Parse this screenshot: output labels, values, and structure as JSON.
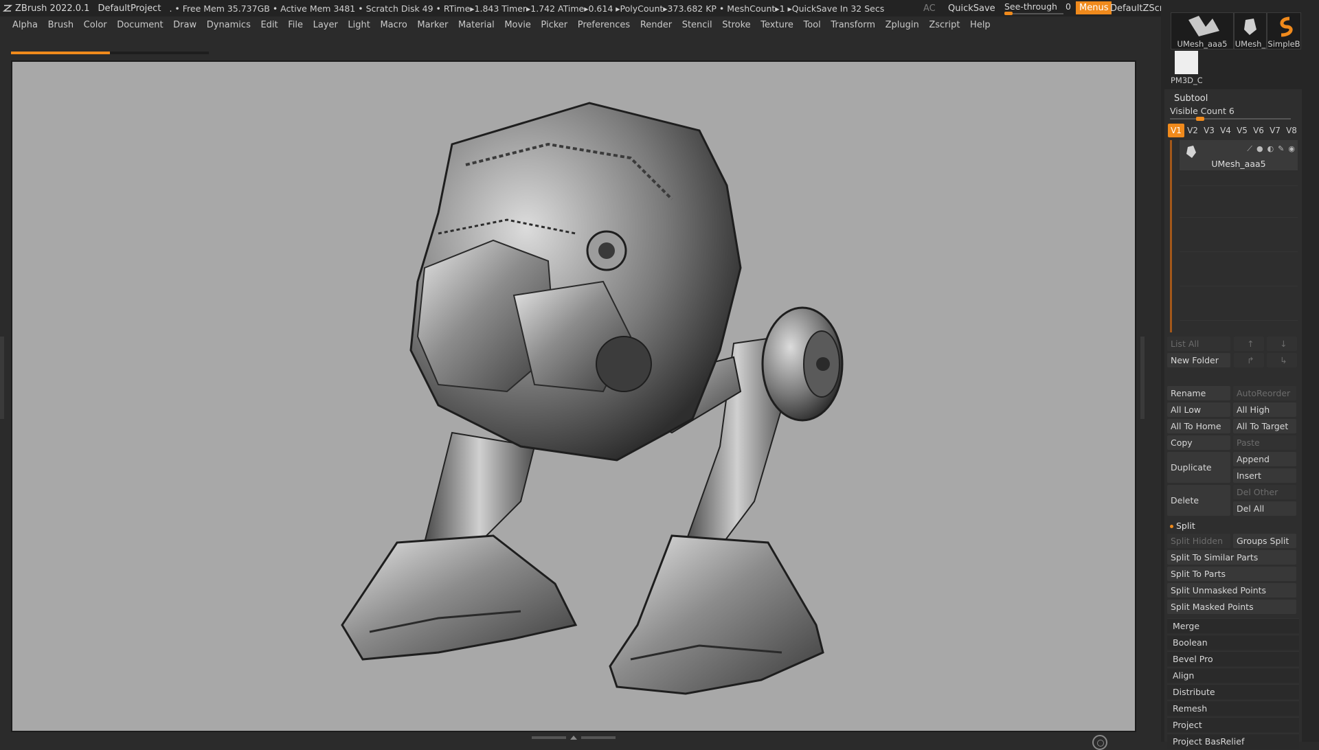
{
  "titlebar": {
    "app": "ZBrush 2022.0.1",
    "project": "DefaultProject",
    "status": ". • Free Mem 35.737GB • Active Mem 3481 • Scratch Disk 49 •  RTime▸1.843 Timer▸1.742 ATime▸0.614 ▸PolyCount▸373.682 KP  • MeshCount▸1  ▸QuickSave In 32 Secs",
    "ac": "AC",
    "quicksave": "QuickSave",
    "seethrough_label": "See-through",
    "seethrough_value": "0",
    "menus": "Menus",
    "zscript": "DefaultZScript"
  },
  "menubar": [
    "Alpha",
    "Brush",
    "Color",
    "Document",
    "Draw",
    "Dynamics",
    "Edit",
    "File",
    "Layer",
    "Light",
    "Macro",
    "Marker",
    "Material",
    "Movie",
    "Picker",
    "Preferences",
    "Render",
    "Stencil",
    "Stroke",
    "Texture",
    "Tool",
    "Transform",
    "Zplugin",
    "Zscript",
    "Help"
  ],
  "progress": {
    "fraction": 0.5
  },
  "tray": {
    "thumbs": [
      "UMesh_aaa5",
      "UMesh_",
      "SimpleB",
      "PM3D_C"
    ]
  },
  "subtool": {
    "title": "Subtool",
    "visible_count": "Visible Count 6",
    "tabs": [
      "V1",
      "V2",
      "V3",
      "V4",
      "V5",
      "V6",
      "V7",
      "V8"
    ],
    "active_tab": "V1",
    "item_name": "UMesh_aaa5",
    "buttons": {
      "list_all": "List All",
      "new_folder": "New Folder",
      "rename": "Rename",
      "autoreorder": "AutoReorder",
      "all_low": "All Low",
      "all_high": "All High",
      "all_to_home": "All To Home",
      "all_to_target": "All To Target",
      "copy": "Copy",
      "paste": "Paste",
      "duplicate": "Duplicate",
      "append": "Append",
      "insert": "Insert",
      "delete": "Delete",
      "del_other": "Del Other",
      "del_all": "Del All"
    },
    "split": {
      "title": "Split",
      "split_hidden": "Split Hidden",
      "groups_split": "Groups Split",
      "split_to_similar": "Split To Similar Parts",
      "split_to_parts": "Split To Parts",
      "split_unmasked": "Split Unmasked Points",
      "split_masked": "Split Masked Points"
    },
    "sections": [
      "Merge",
      "Boolean",
      "Bevel Pro",
      "Align",
      "Distribute",
      "Remesh",
      "Project",
      "Project BasRelief"
    ]
  },
  "colors": {
    "accent": "#f08a1c",
    "canvas": "#a8a8a8",
    "panel": "#2e2e2e"
  },
  "icons": [
    "zbrush-logo-icon",
    "nav-gizmo-icon",
    "eye-icon",
    "paint-icon"
  ]
}
